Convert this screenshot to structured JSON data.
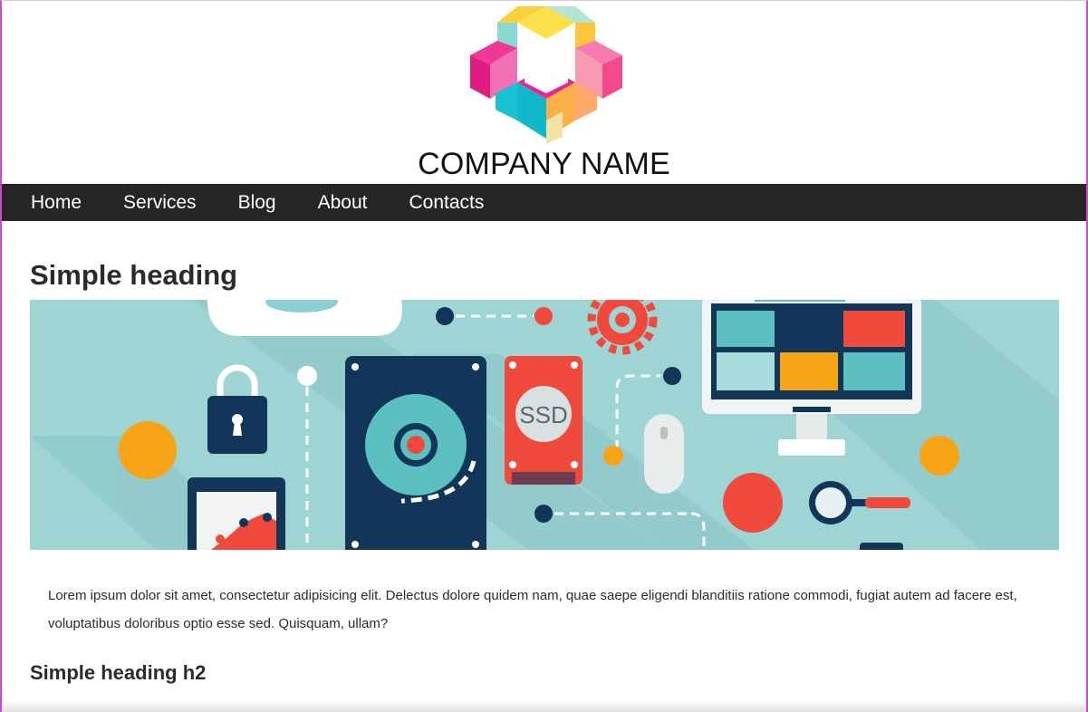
{
  "header": {
    "company_name": "COMPANY NAME",
    "logo_icon": "colorful-hexagon-cube-logo"
  },
  "nav": {
    "items": [
      {
        "label": "Home"
      },
      {
        "label": "Services"
      },
      {
        "label": "Blog"
      },
      {
        "label": "About"
      },
      {
        "label": "Contacts"
      }
    ]
  },
  "main": {
    "heading": "Simple heading",
    "banner": {
      "ssd_label": "SSD",
      "icons": [
        "cloud-icon",
        "padlock-icon",
        "hard-drive-icon",
        "ssd-icon",
        "gear-icon",
        "mouse-icon",
        "monitor-icon",
        "magnifier-icon",
        "tablet-chart-icon"
      ]
    },
    "paragraph": "Lorem ipsum dolor sit amet, consectetur adipisicing elit. Delectus dolore quidem nam, quae saepe eligendi blanditiis ratione commodi, fugiat autem ad facere est, voluptatibus doloribus optio esse sed. Quisquam, ullam?",
    "subheading": "Simple heading h2"
  },
  "colors": {
    "nav_bg": "#262626",
    "banner_bg": "#9fd4d5",
    "accent_navy": "#12365a",
    "accent_red": "#ef4a3c",
    "accent_orange": "#f7a416",
    "frame_border": "#c94cc3"
  }
}
